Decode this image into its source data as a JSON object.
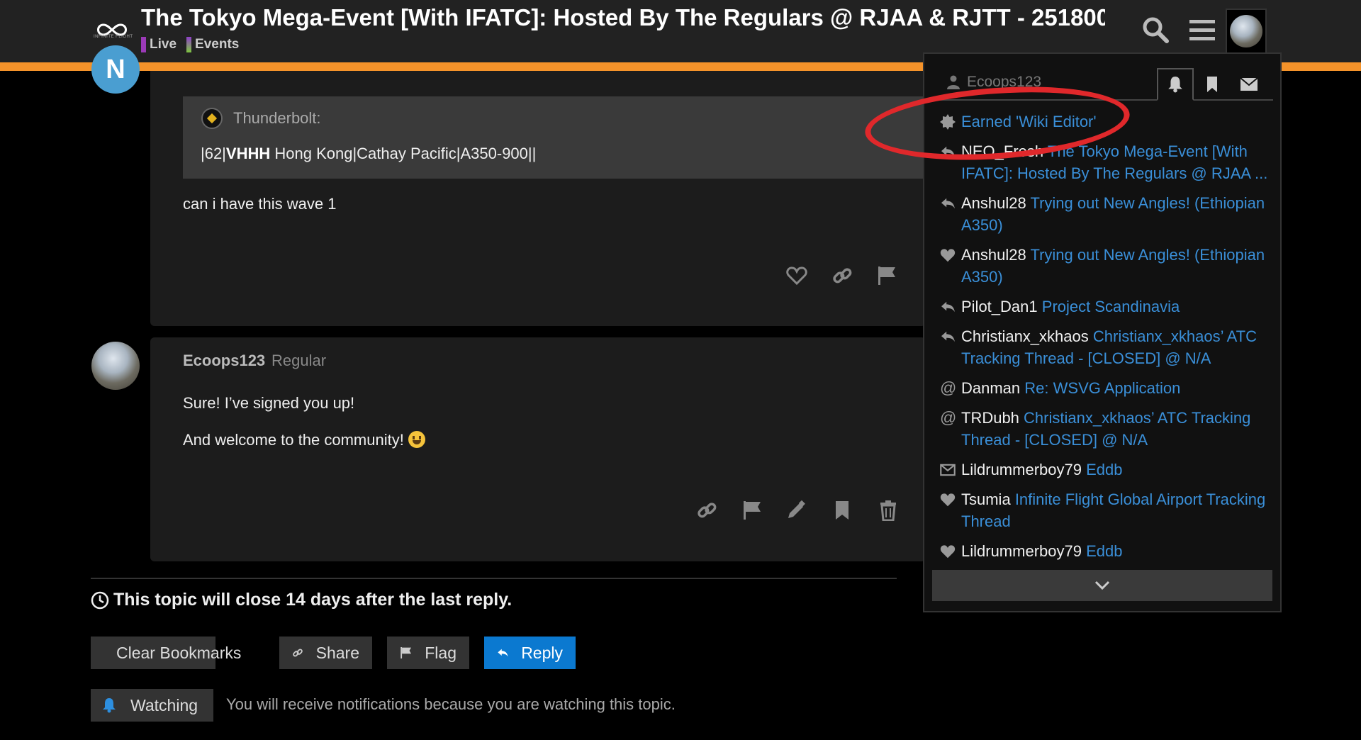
{
  "header": {
    "logo_text": "INFINITE FLIGHT",
    "title": "The Tokyo Mega-Event [With IFATC]: Hosted By The Regulars @ RJAA & RJTT - 251800…",
    "categories": [
      {
        "label": "Live",
        "color": "#9b3ab7"
      },
      {
        "label": "Events",
        "color": "#7a44c2"
      }
    ],
    "accent_color": "#f5932a",
    "icons": [
      "search-icon",
      "hamburger-icon",
      "user-avatar"
    ]
  },
  "post1": {
    "avatar_letter": "N",
    "quote": {
      "author": "Thunderbolt:",
      "pre": "|62|",
      "bold": "VHHH",
      "post": " Hong Kong|Cathay Pacific|A350-900||"
    },
    "body": "can i have this wave 1",
    "actions": [
      "heart-icon",
      "link-icon",
      "flag-icon"
    ]
  },
  "post2": {
    "username": "Ecoops123",
    "user_title": "Regular",
    "lines": [
      "Sure! I’ve signed you up!",
      "And welcome to the community!"
    ],
    "actions": [
      "link-icon",
      "flag-icon",
      "pencil-icon",
      "bookmark-icon",
      "trash-icon"
    ]
  },
  "footer": {
    "close_note": "This topic will close 14 days after the last reply.",
    "buttons": {
      "clear_bookmarks": "Clear Bookmarks",
      "share": "Share",
      "flag": "Flag",
      "reply": "Reply"
    },
    "watching_label": "Watching",
    "watching_note": "You will receive notifications because you are watching this topic."
  },
  "panel": {
    "username": "Ecoops123",
    "tabs": [
      "bell-icon",
      "bookmark-icon",
      "envelope-icon"
    ],
    "notifications": [
      {
        "icon": "badge-icon",
        "user": "",
        "text": "Earned 'Wiki Editor'"
      },
      {
        "icon": "reply-icon",
        "user": "NEO_Fresh",
        "text": "The Tokyo Mega-Event [With IFATC]: Hosted By The Regulars @ RJAA ..."
      },
      {
        "icon": "reply-icon",
        "user": "Anshul28",
        "text": "Trying out New Angles! (Ethiopian A350)"
      },
      {
        "icon": "heart-icon",
        "user": "Anshul28",
        "text": "Trying out New Angles! (Ethiopian A350)"
      },
      {
        "icon": "reply-icon",
        "user": "Pilot_Dan1",
        "text": "Project Scandinavia"
      },
      {
        "icon": "reply-icon",
        "user": "Christianx_xkhaos",
        "text": "Christianx_xkhaos’ ATC Tracking Thread - [CLOSED] @ N/A"
      },
      {
        "icon": "at-icon",
        "user": "Danman",
        "text": "Re: WSVG Application"
      },
      {
        "icon": "at-icon",
        "user": "TRDubh",
        "text": "Christianx_xkhaos’ ATC Tracking Thread - [CLOSED] @ N/A"
      },
      {
        "icon": "envelope-icon",
        "user": "Lildrummerboy79",
        "text": "Eddb"
      },
      {
        "icon": "heart-icon",
        "user": "Tsumia",
        "text": "Infinite Flight Global Airport Tracking Thread"
      },
      {
        "icon": "heart-icon",
        "user": "Lildrummerboy79",
        "text": "Eddb"
      }
    ],
    "link_color": "#3a8fd8"
  }
}
